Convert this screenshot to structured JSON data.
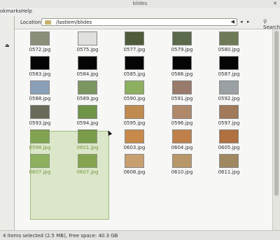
{
  "window": {
    "title": "blides"
  },
  "window_controls": {
    "close": "✕"
  },
  "menubar": {
    "items": [
      "okmarks",
      "Help"
    ]
  },
  "sidebar": {
    "eject_glyph": "⏏"
  },
  "toolbar": {
    "location_label": "Location:",
    "location_value": "/lastiem/blides",
    "clear_glyph": "◀",
    "back_glyph": "◂",
    "forward_glyph": "▸",
    "search_label": "Search"
  },
  "files": [
    {
      "name": "0572.jpg",
      "color": "#8a8f7a",
      "selected": false
    },
    {
      "name": "0575.jpg",
      "color": "#e0e0dc",
      "selected": false
    },
    {
      "name": "0577.jpg",
      "color": "#4f5b3a",
      "selected": false
    },
    {
      "name": "0579.jpg",
      "color": "#5a6a4a",
      "selected": false
    },
    {
      "name": "0580.jpg",
      "color": "#6e7a56",
      "selected": false
    },
    {
      "name": "0583.jpg",
      "color": "#050505",
      "selected": false
    },
    {
      "name": "0584.jpg",
      "color": "#050505",
      "selected": false
    },
    {
      "name": "0585.jpg",
      "color": "#050505",
      "selected": false
    },
    {
      "name": "0586.jpg",
      "color": "#050505",
      "selected": false
    },
    {
      "name": "0587.jpg",
      "color": "#050505",
      "selected": false
    },
    {
      "name": "0588.jpg",
      "color": "#8aa0b8",
      "selected": false
    },
    {
      "name": "0589.jpg",
      "color": "#7b9660",
      "selected": false
    },
    {
      "name": "0590.jpg",
      "color": "#8db060",
      "selected": false
    },
    {
      "name": "0591.jpg",
      "color": "#9a7a6a",
      "selected": false
    },
    {
      "name": "0592.jpg",
      "color": "#9aa0a4",
      "selected": false
    },
    {
      "name": "0593.jpg",
      "color": "#6a6a5a",
      "selected": false
    },
    {
      "name": "0594.jpg",
      "color": "#6e9448",
      "selected": false
    },
    {
      "name": "0595.jpg",
      "color": "#c08a50",
      "selected": false
    },
    {
      "name": "0596.jpg",
      "color": "#b0886a",
      "selected": false
    },
    {
      "name": "0597.jpg",
      "color": "#a07a5a",
      "selected": false
    },
    {
      "name": "0598.jpg",
      "color": "#7a9a50",
      "selected": true
    },
    {
      "name": "0601.jpg",
      "color": "#6f8f44",
      "selected": true
    },
    {
      "name": "0603.jpg",
      "color": "#c88a4a",
      "selected": false
    },
    {
      "name": "0604.jpg",
      "color": "#c0804a",
      "selected": false
    },
    {
      "name": "0605.jpg",
      "color": "#b07040",
      "selected": false
    },
    {
      "name": "0607.jpg",
      "color": "#8aaa60",
      "selected": true
    },
    {
      "name": "0607.jpg",
      "color": "#7f9a50",
      "selected": true
    },
    {
      "name": "0608.jpg",
      "color": "#c8a070",
      "selected": false
    },
    {
      "name": "0610.jpg",
      "color": "#b89868",
      "selected": false
    },
    {
      "name": "0611.jpg",
      "color": "#a08860",
      "selected": false
    }
  ],
  "statusbar": {
    "text": "4 items selected (2.5 MB), Free space: 40.3 GB"
  }
}
